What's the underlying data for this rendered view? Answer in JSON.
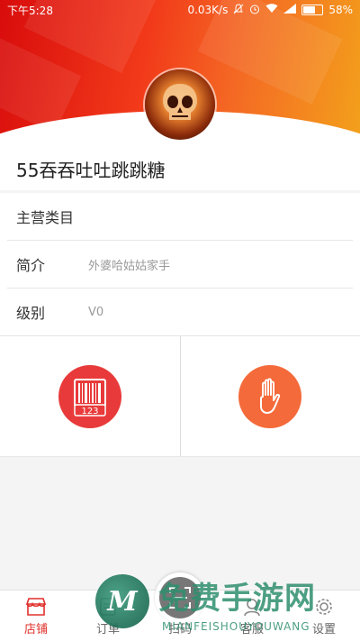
{
  "status": {
    "time": "下午5:28",
    "speed": "0.03K/s",
    "battery": "58%"
  },
  "shop": {
    "name": "55吞吞吐吐跳跳糖"
  },
  "info_rows": [
    {
      "label": "主营类目",
      "value": ""
    },
    {
      "label": "简介",
      "value": "外婆哈姑姑家手"
    },
    {
      "label": "级别",
      "value": "V0"
    }
  ],
  "actions": [
    {
      "icon": "barcode-icon",
      "badge": "123",
      "color": "#e83a3a"
    },
    {
      "icon": "hand-stop-icon",
      "color": "#f46a3a"
    }
  ],
  "tabs": [
    {
      "label": "店铺",
      "icon": "store-icon",
      "active": true
    },
    {
      "label": "订单",
      "icon": "order-icon"
    },
    {
      "label": "扫码",
      "icon": "scan-icon"
    },
    {
      "label": "客服",
      "icon": "service-icon"
    },
    {
      "label": "设置",
      "icon": "settings-icon"
    }
  ],
  "watermark": {
    "title": "免费手游网",
    "sub": "MIANFEISHOUYOUWANG",
    "logo_letter": "M"
  },
  "colors": {
    "accent": "#e0302b",
    "header_start": "#d80c0c",
    "header_end": "#f3a11b"
  }
}
